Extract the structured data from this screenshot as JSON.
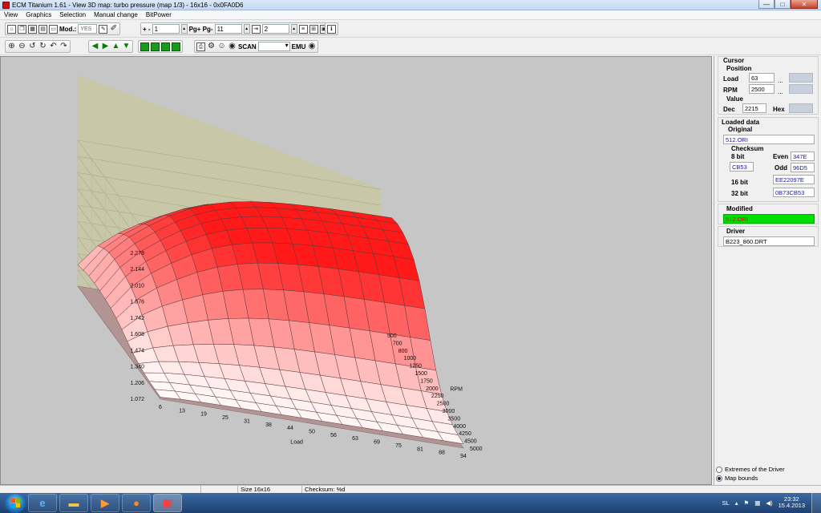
{
  "window": {
    "title": "ECM Titanium 1.61 - View 3D map: turbo pressure (map 1/3) - 16x16 - 0x0FA0D6",
    "minimize": "—",
    "maximize": "□",
    "close": "✕"
  },
  "menu": [
    "View",
    "Graphics",
    "Selection",
    "Manual change",
    "BitPower"
  ],
  "toolbar": {
    "mod_label": "Mod.:",
    "mod_value": "YES",
    "plus_minus": "+ -",
    "step_value": "1",
    "pg_label": "Pg+ Pg-",
    "pg_value": "11",
    "second_value": "2",
    "scan_label": "SCAN",
    "emu_label": "EMU"
  },
  "chart_data": {
    "type": "surface3d",
    "title": "",
    "xlabel": "Load",
    "ylabel": "RPM",
    "zlabel": "",
    "x_ticks": [
      6,
      13,
      19,
      25,
      31,
      38,
      44,
      50,
      56,
      63,
      69,
      75,
      81,
      88,
      94
    ],
    "y_ticks": [
      500,
      700,
      800,
      1000,
      1250,
      1500,
      1750,
      2000,
      2250,
      2500,
      3000,
      3500,
      4000,
      4250,
      4500,
      5000
    ],
    "z_ticks": [
      1.072,
      1.206,
      1.34,
      1.474,
      1.608,
      1.742,
      1.876,
      2.01,
      2.144,
      2.278
    ],
    "zlim": [
      1.072,
      2.278
    ],
    "colors": {
      "low": "#ffffff",
      "high": "#ff1a1a",
      "floor": "#b39494",
      "wall_left": "#dcdcb4",
      "wall_back": "#c8c8a8"
    }
  },
  "cursor": {
    "title": "Cursor",
    "position_title": "Position",
    "load_label": "Load",
    "load_value": "63",
    "rpm_label": "RPM",
    "rpm_value": "2500",
    "ellipsis": "...",
    "value_title": "Value",
    "dec_label": "Dec",
    "dec_value": "2215",
    "hex_label": "Hex"
  },
  "loaded": {
    "title": "Loaded data",
    "original_title": "Original",
    "original_file": "512.ORI",
    "checksum_title": "Checksum",
    "bit8_label": "8 bit",
    "bit8_value": "CB53",
    "even_label": "Even",
    "even_value": "347E",
    "odd_label": "Odd",
    "odd_value": "96D5",
    "bit16_label": "16 bit",
    "bit16_value": "EE22097E",
    "bit32_label": "32 bit",
    "bit32_value": "0B73CB53"
  },
  "modified": {
    "title": "Modified",
    "file": "512.ORI"
  },
  "driver": {
    "title": "Driver",
    "file": "B223_860.DRT"
  },
  "options": {
    "extremes_label": "Extremes of the Driver",
    "bounds_label": "Map bounds"
  },
  "status": {
    "size": "Size 16x16",
    "checksum": "Checksum: %d"
  },
  "taskbar": {
    "lang": "SL",
    "time": "23:32",
    "date": "15.4.2013"
  }
}
